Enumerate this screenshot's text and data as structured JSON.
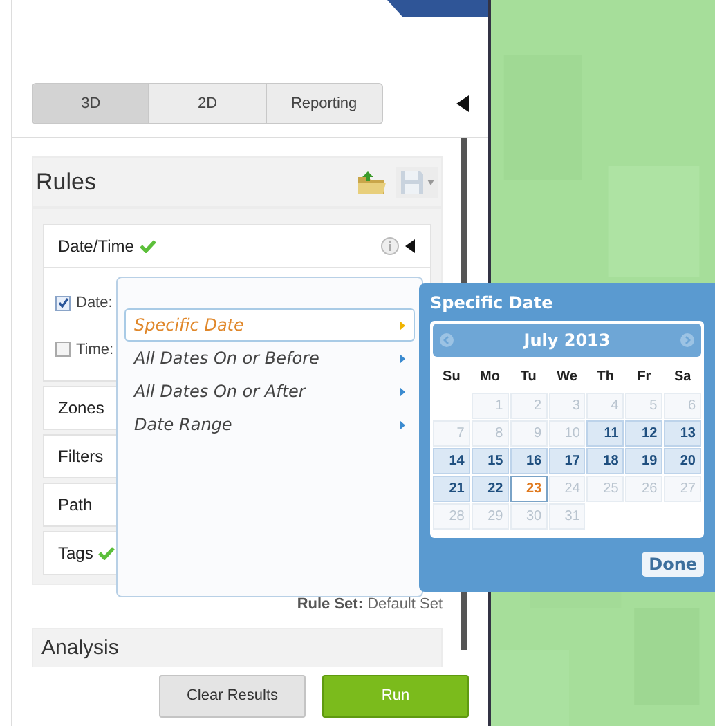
{
  "tabs": [
    {
      "label": "3D",
      "selected": true
    },
    {
      "label": "2D",
      "selected": false
    },
    {
      "label": "Reporting",
      "selected": false
    }
  ],
  "rules": {
    "title": "Rules",
    "sections": [
      {
        "label": "Date/Time",
        "valid": true,
        "expanded": true,
        "options": [
          {
            "label": "Date:",
            "checked": true
          },
          {
            "label": "Time:",
            "checked": false
          }
        ]
      },
      {
        "label": "Zones",
        "valid": false,
        "expanded": false
      },
      {
        "label": "Filters",
        "valid": false,
        "expanded": false
      },
      {
        "label": "Path",
        "valid": false,
        "expanded": false
      },
      {
        "label": "Tags",
        "valid": true,
        "expanded": false
      }
    ]
  },
  "rule_set": {
    "label": "Rule Set:",
    "value": "Default Set"
  },
  "analysis": {
    "title": "Analysis"
  },
  "buttons": [
    {
      "label": "Clear Results",
      "kind": "secondary"
    },
    {
      "label": "Run",
      "kind": "primary"
    }
  ],
  "date_menu": {
    "items": [
      {
        "label": "Specific Date",
        "selected": true
      },
      {
        "label": "All Dates On or Before",
        "selected": false
      },
      {
        "label": "All Dates On or After",
        "selected": false
      },
      {
        "label": "Date Range",
        "selected": false
      }
    ]
  },
  "calendar": {
    "title": "Specific Date",
    "month": "July 2013",
    "weekdays": [
      "Su",
      "Mo",
      "Tu",
      "We",
      "Th",
      "Fr",
      "Sa"
    ],
    "done": "Done",
    "weeks": [
      {
        "days": [
          {
            "kind": "blank"
          },
          {
            "day": "1",
            "kind": "disabled"
          },
          {
            "day": "2",
            "kind": "disabled"
          },
          {
            "day": "3",
            "kind": "disabled"
          },
          {
            "day": "4",
            "kind": "disabled"
          },
          {
            "day": "5",
            "kind": "disabled"
          },
          {
            "day": "6",
            "kind": "disabled"
          }
        ]
      },
      {
        "days": [
          {
            "day": "7",
            "kind": "disabled"
          },
          {
            "day": "8",
            "kind": "disabled"
          },
          {
            "day": "9",
            "kind": "disabled"
          },
          {
            "day": "10",
            "kind": "disabled"
          },
          {
            "day": "11",
            "kind": "available"
          },
          {
            "day": "12",
            "kind": "available"
          },
          {
            "day": "13",
            "kind": "available"
          }
        ]
      },
      {
        "days": [
          {
            "day": "14",
            "kind": "available"
          },
          {
            "day": "15",
            "kind": "available"
          },
          {
            "day": "16",
            "kind": "available"
          },
          {
            "day": "17",
            "kind": "available"
          },
          {
            "day": "18",
            "kind": "available"
          },
          {
            "day": "19",
            "kind": "available"
          },
          {
            "day": "20",
            "kind": "available"
          }
        ]
      },
      {
        "days": [
          {
            "day": "21",
            "kind": "available"
          },
          {
            "day": "22",
            "kind": "available"
          },
          {
            "day": "23",
            "kind": "today"
          },
          {
            "day": "24",
            "kind": "disabled"
          },
          {
            "day": "25",
            "kind": "disabled"
          },
          {
            "day": "26",
            "kind": "disabled"
          },
          {
            "day": "27",
            "kind": "disabled"
          }
        ]
      },
      {
        "days": [
          {
            "day": "28",
            "kind": "disabled"
          },
          {
            "day": "29",
            "kind": "disabled"
          },
          {
            "day": "30",
            "kind": "disabled"
          },
          {
            "day": "31",
            "kind": "disabled"
          }
        ]
      }
    ]
  }
}
